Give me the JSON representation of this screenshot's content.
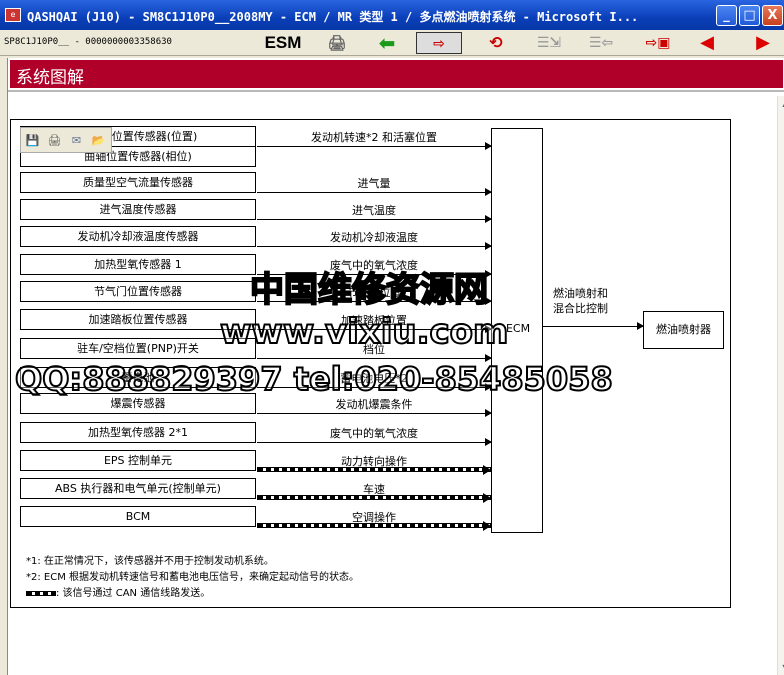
{
  "window": {
    "title": "QASHQAI (J10) - SM8C1J10P0__2008MY - ECM / MR 类型 1 / 多点燃油喷射系统 - Microsoft I...",
    "min_label": "_",
    "max_label": "□",
    "close_label": "X"
  },
  "toolbar": {
    "doc_id": "SP8C1J10P0__ - 0000000003358630",
    "esm_label": "ESM",
    "printer_glyph": "🖨",
    "back_glyph": "⬅",
    "forward_glyph": "⇨",
    "refresh_glyph": "⟲",
    "prev_glyph": "◀",
    "next_glyph": "▶"
  },
  "page": {
    "title": "系统图解"
  },
  "diagram": {
    "inputs": [
      {
        "box": "凸轮轴位置传感器(位置)",
        "signal": "发动机转速*2 和活塞位置",
        "type": "wire"
      },
      {
        "box": "曲轴位置传感器(相位)",
        "signal": "",
        "type": "wire"
      },
      {
        "box": "质量型空气流量传感器",
        "signal": "进气量",
        "type": "wire"
      },
      {
        "box": "进气温度传感器",
        "signal": "进气温度",
        "type": "wire"
      },
      {
        "box": "发动机冷却液温度传感器",
        "signal": "发动机冷却液温度",
        "type": "wire"
      },
      {
        "box": "加热型氧传感器 1",
        "signal": "废气中的氧气浓度",
        "type": "wire"
      },
      {
        "box": "节气门位置传感器",
        "signal": "节气门位置",
        "type": "wire"
      },
      {
        "box": "加速踏板位置传感器",
        "signal": "加速踏板位置",
        "type": "wire"
      },
      {
        "box": "驻车/空档位置(PNP)开关",
        "signal": "档位",
        "type": "wire"
      },
      {
        "box": "蓄电池",
        "signal": "蓄电池电压*2",
        "type": "wire"
      },
      {
        "box": "爆震传感器",
        "signal": "发动机爆震条件",
        "type": "wire"
      },
      {
        "box": "加热型氧传感器 2*1",
        "signal": "废气中的氧气浓度",
        "type": "wire"
      },
      {
        "box": "EPS 控制单元",
        "signal": "动力转向操作",
        "type": "can"
      },
      {
        "box": "ABS 执行器和电气单元(控制单元)",
        "signal": "车速",
        "type": "can"
      },
      {
        "box": "BCM",
        "signal": "空调操作",
        "type": "can"
      }
    ],
    "ecm_label": "ECM",
    "output_label_1": "燃油喷射和",
    "output_label_2": "混合比控制",
    "actuator": "燃油喷射器",
    "notes": {
      "n1": "*1: 在正常情况下，该传感器并不用于控制发动机系统。",
      "n2": "*2: ECM 根据发动机转速信号和蓄电池电压信号，来确定起动信号的状态。",
      "n3": ": 该信号通过 CAN 通信线路发送。"
    }
  },
  "watermark": {
    "line1": "中国维修资源网",
    "line2": "www.vixiu.com",
    "line3": "QQ:888829397 tel:020-85485058"
  }
}
